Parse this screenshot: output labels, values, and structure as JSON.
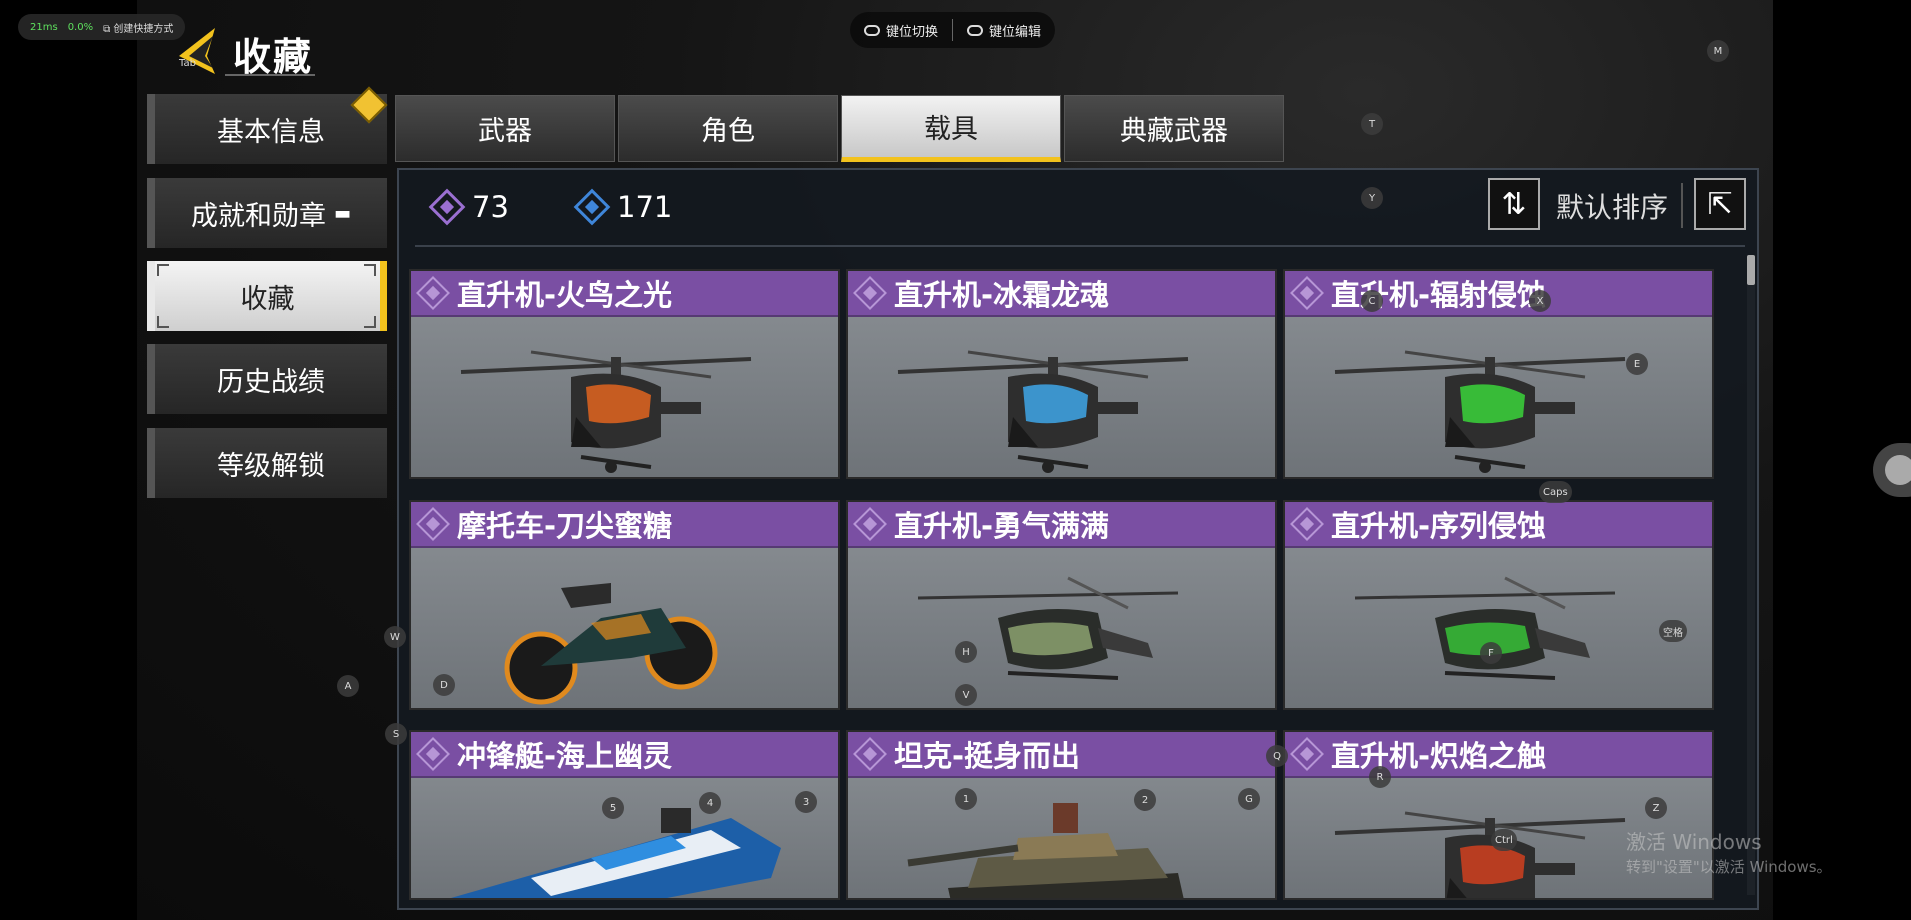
{
  "overlay": {
    "latency": "21ms",
    "loss": "0.0%",
    "shortcut": "创建快捷方式",
    "key_switch": "键位切换",
    "key_edit": "键位编辑"
  },
  "header": {
    "tab_hint": "Tab",
    "title": "收藏"
  },
  "sidebar": {
    "items": [
      {
        "label": "基本信息"
      },
      {
        "label": "成就和勋章"
      },
      {
        "label": "收藏"
      },
      {
        "label": "历史战绩"
      },
      {
        "label": "等级解锁"
      }
    ],
    "active_index": 2
  },
  "tabs": {
    "items": [
      {
        "label": "武器"
      },
      {
        "label": "角色"
      },
      {
        "label": "载具"
      },
      {
        "label": "典藏武器"
      }
    ],
    "active_index": 2
  },
  "currencies": {
    "purple": "73",
    "blue": "171"
  },
  "sort": {
    "label": "默认排序"
  },
  "cards": [
    {
      "name": "直升机-火鸟之光",
      "type": "heli",
      "accent": "#e0641e"
    },
    {
      "name": "直升机-冰霜龙魂",
      "type": "heli",
      "accent": "#3ea6e8"
    },
    {
      "name": "直升机-辐射侵蚀",
      "type": "heli",
      "accent": "#39d439"
    },
    {
      "name": "摩托车-刀尖蜜糖",
      "type": "moto",
      "accent": "#e08a1e"
    },
    {
      "name": "直升机-勇气满满",
      "type": "heli2",
      "accent": "#9ab27a"
    },
    {
      "name": "直升机-序列侵蚀",
      "type": "heli2",
      "accent": "#39d439"
    },
    {
      "name": "冲锋艇-海上幽灵",
      "type": "boat",
      "accent": "#2f8ee0"
    },
    {
      "name": "坦克-挺身而出",
      "type": "tank",
      "accent": "#8a7a55"
    },
    {
      "name": "直升机-炽焰之触",
      "type": "heli",
      "accent": "#d0401e"
    }
  ],
  "keyhints": {
    "m": "M",
    "t": "T",
    "y": "Y",
    "c": "C",
    "x": "X",
    "e": "E",
    "caps": "Caps",
    "w": "W",
    "a": "A",
    "d": "D",
    "h": "H",
    "v": "V",
    "f": "F",
    "space": "空格",
    "s": "S",
    "q": "Q",
    "r": "R",
    "k5": "5",
    "k4": "4",
    "k3": "3",
    "k1": "1",
    "k2": "2",
    "g": "G",
    "z": "Z",
    "ctrl": "Ctrl"
  },
  "watermark": {
    "line1": "激活 Windows",
    "line2": "转到\"设置\"以激活 Windows。"
  },
  "colors": {
    "accent_yellow": "#f2c21d",
    "card_header_purple": "#7a4fa3",
    "currency_purple": "#9a6fd1",
    "currency_blue": "#3f86d9"
  }
}
